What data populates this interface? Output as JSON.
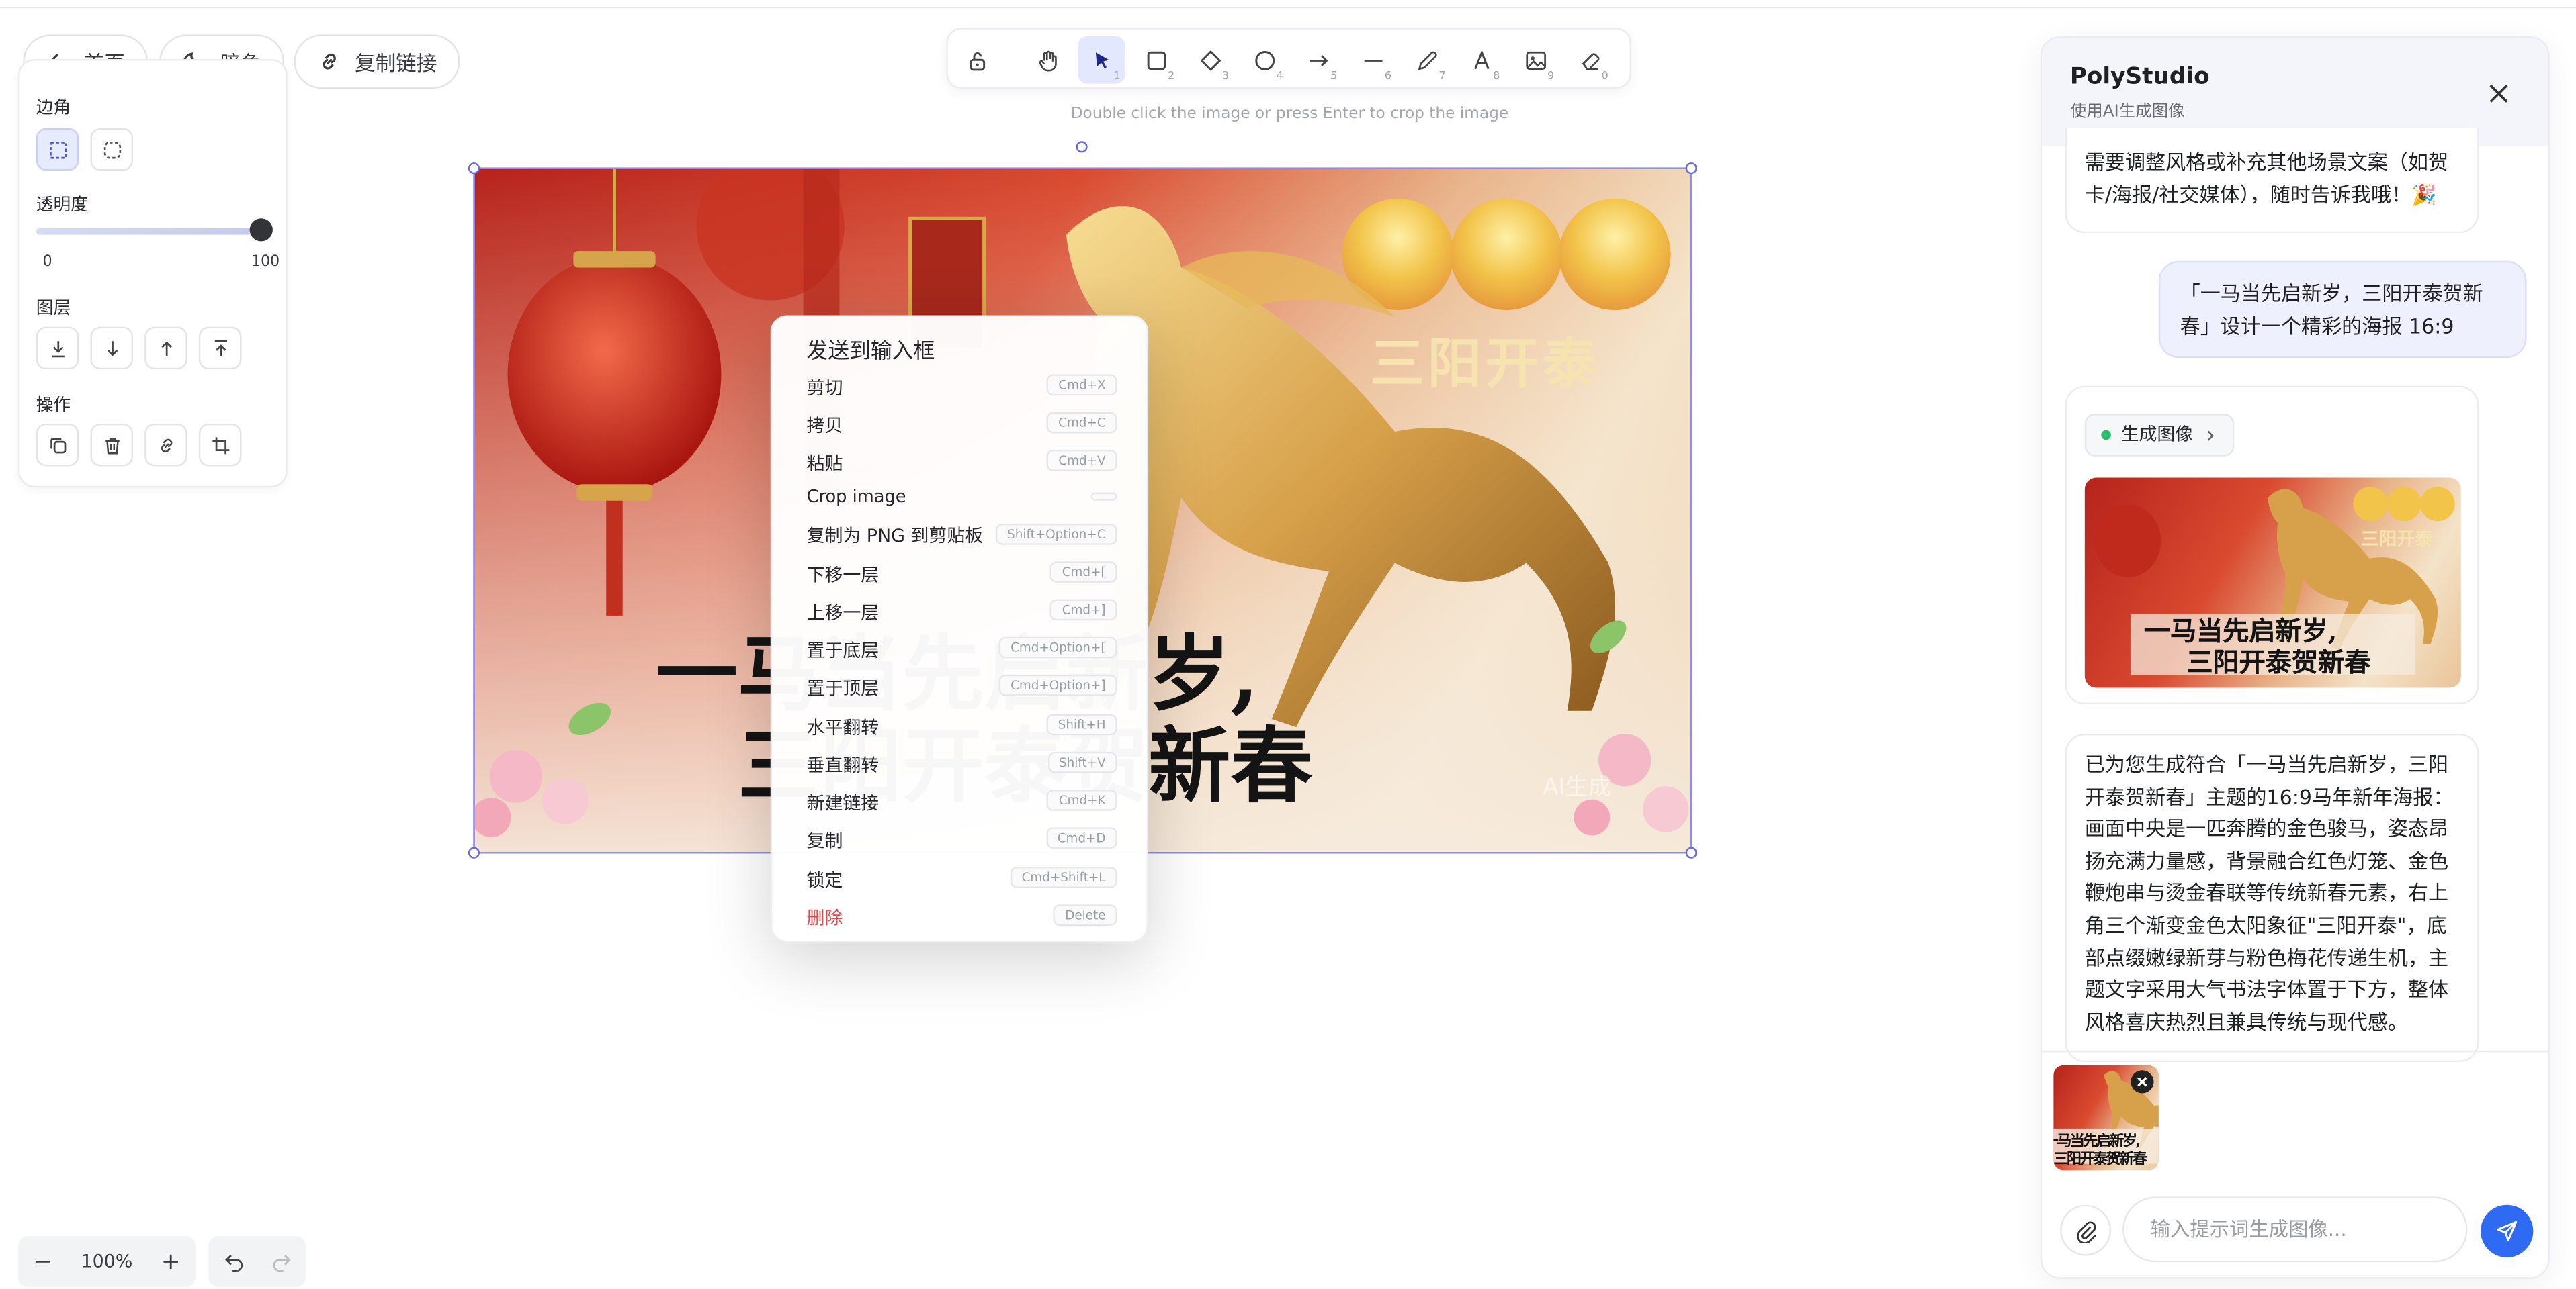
{
  "top_pills": {
    "home": "首页",
    "dark": "暗色",
    "copy_link": "复制链接"
  },
  "props": {
    "corner_label": "边角",
    "opacity_label": "透明度",
    "opacity_value": 100,
    "opacity_min": "0",
    "opacity_max": "100",
    "layer_label": "图层",
    "action_label": "操作"
  },
  "toolbar": {
    "tools": [
      {
        "name": "lock-tool",
        "num": ""
      },
      {
        "name": "hand-tool",
        "num": ""
      },
      {
        "name": "select-tool",
        "num": "1"
      },
      {
        "name": "rectangle-tool",
        "num": "2"
      },
      {
        "name": "diamond-tool",
        "num": "3"
      },
      {
        "name": "ellipse-tool",
        "num": "4"
      },
      {
        "name": "arrow-tool",
        "num": "5"
      },
      {
        "name": "line-tool",
        "num": "6"
      },
      {
        "name": "pen-tool",
        "num": "7"
      },
      {
        "name": "text-tool",
        "num": "8"
      },
      {
        "name": "image-tool",
        "num": "9"
      },
      {
        "name": "eraser-tool",
        "num": "0"
      }
    ],
    "hint": "Double click the image or press Enter to crop the image"
  },
  "poster": {
    "title": "三阳开泰",
    "line1": "一马当先启新岁,",
    "line2": "三阳开泰贺新春",
    "watermark": "AI生成"
  },
  "context_menu": {
    "items": [
      {
        "label": "发送到输入框",
        "shortcut": ""
      },
      {
        "label": "剪切",
        "shortcut": "Cmd+X"
      },
      {
        "label": "拷贝",
        "shortcut": "Cmd+C"
      },
      {
        "label": "粘贴",
        "shortcut": "Cmd+V"
      },
      {
        "label": "Crop image",
        "shortcut": ""
      },
      {
        "label": "复制为 PNG 到剪贴板",
        "shortcut": "Shift+Option+C"
      },
      {
        "label": "下移一层",
        "shortcut": "Cmd+["
      },
      {
        "label": "上移一层",
        "shortcut": "Cmd+]"
      },
      {
        "label": "置于底层",
        "shortcut": "Cmd+Option+["
      },
      {
        "label": "置于顶层",
        "shortcut": "Cmd+Option+]"
      },
      {
        "label": "水平翻转",
        "shortcut": "Shift+H"
      },
      {
        "label": "垂直翻转",
        "shortcut": "Shift+V"
      },
      {
        "label": "新建链接",
        "shortcut": "Cmd+K"
      },
      {
        "label": "复制",
        "shortcut": "Cmd+D"
      },
      {
        "label": "锁定",
        "shortcut": "Cmd+Shift+L"
      },
      {
        "label": "删除",
        "shortcut": "Delete"
      }
    ]
  },
  "zoom": {
    "minus": "−",
    "level": "100%",
    "plus": "+"
  },
  "chat": {
    "title": "PolyStudio",
    "subtitle": "使用AI生成图像",
    "msg1_line1": "需要调整风格或补充其他场景文案（如贺",
    "msg1_line2": "卡/海报/社交媒体），随时告诉我哦！🎉",
    "user_line1": "「一马当先启新岁，三阳开泰贺新",
    "user_line2": "春」设计一个精彩的海报 16:9",
    "chip_label": "生成图像",
    "result_lines": [
      "已为您生成符合「一马当先启新岁，三阳",
      "开泰贺新春」主题的16:9马年新年海报：",
      "画面中央是一匹奔腾的金色骏马，姿态昂",
      "扬充满力量感，背景融合红色灯笼、金色",
      "鞭炮串与烫金春联等传统新春元素，右上",
      "角三个渐变金色太阳象征\"三阳开泰\"，底",
      "部点缀嫩绿新芽与粉色梅花传递生机，主",
      "题文字采用大气书法字体置于下方，整体",
      "风格喜庆热烈且兼具传统与现代感。"
    ],
    "input_placeholder": "输入提示词生成图像..."
  },
  "colors": {
    "accent": "#2f6bf2",
    "selection": "#8d8df0",
    "danger": "#e5484d",
    "poster_red": "#c62f21",
    "gold": "#d9a441"
  }
}
